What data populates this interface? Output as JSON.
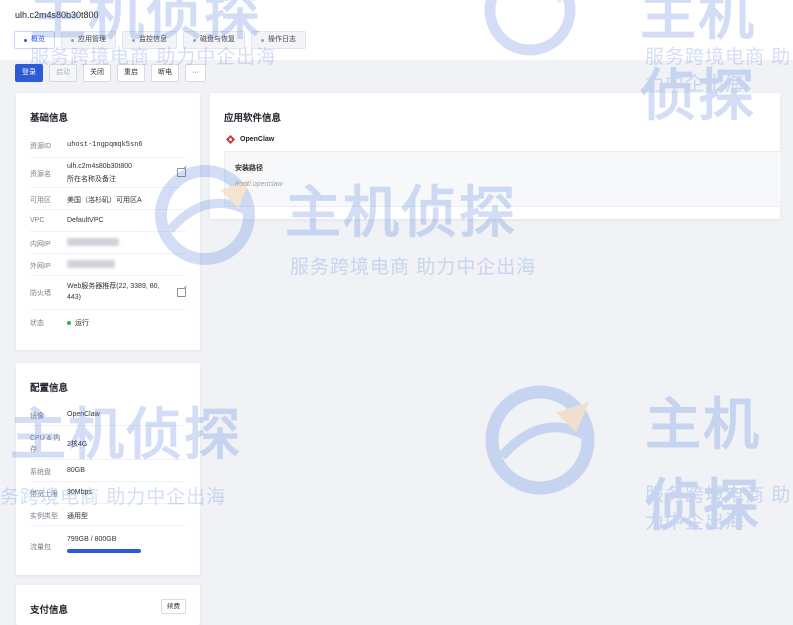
{
  "host": {
    "title": "ulh.c2m4s80b30t800"
  },
  "tabs": [
    {
      "label": "概览",
      "active": true
    },
    {
      "label": "应用管理",
      "active": false
    },
    {
      "label": "监控信息",
      "active": false
    },
    {
      "label": "磁盘与恢复",
      "active": false
    },
    {
      "label": "操作日志",
      "active": false
    }
  ],
  "actions": {
    "login": "登录",
    "start": "启动",
    "shutdown": "关闭",
    "restart": "重启",
    "power_off": "断电",
    "more": "···"
  },
  "basic": {
    "title": "基础信息",
    "resource_id_label": "资源ID",
    "resource_id": "uhost-1ngpqmqk5sn6",
    "resource_name_label": "资源名",
    "resource_name": "ulh.c2m4s80b30t800",
    "resource_name_sub": "所在名称及备注",
    "zone_label": "可用区",
    "zone": "美国（洛杉矶）可用区A",
    "vpc_label": "VPC",
    "vpc": "DefaultVPC",
    "private_ip_label": "内网IP",
    "public_ip_label": "外网IP",
    "firewall_label": "防火墙",
    "firewall": "Web服务器推荐(22, 3389, 80, 443)",
    "status_label": "状态",
    "status": "运行",
    "status_color": "#2fb254"
  },
  "config": {
    "title": "配置信息",
    "image_label": "镜像",
    "image": "OpenClaw",
    "cpu_label": "CPU & 内存",
    "cpu": "2核4G",
    "disk_label": "系统盘",
    "disk": "80GB",
    "bandwidth_label": "带宽上限",
    "bandwidth": "30Mbps",
    "instance_type_label": "实例类型",
    "instance_type": "通用型",
    "traffic_label": "流量包",
    "traffic": "799GB / 800GB",
    "traffic_used_fraction": 0.999
  },
  "payment": {
    "title": "支付信息",
    "renew_label": "续费"
  },
  "software": {
    "title": "应用软件信息",
    "app_name": "OpenClaw",
    "install_path_label": "安装路径",
    "install_path": "/root/.openclaw"
  },
  "watermark": {
    "logo": "主机侦探",
    "slogan": "服务跨境电商 助力中企出海"
  },
  "colors": {
    "accent": "#2d5bd6",
    "app_icon": "#d0343a"
  }
}
